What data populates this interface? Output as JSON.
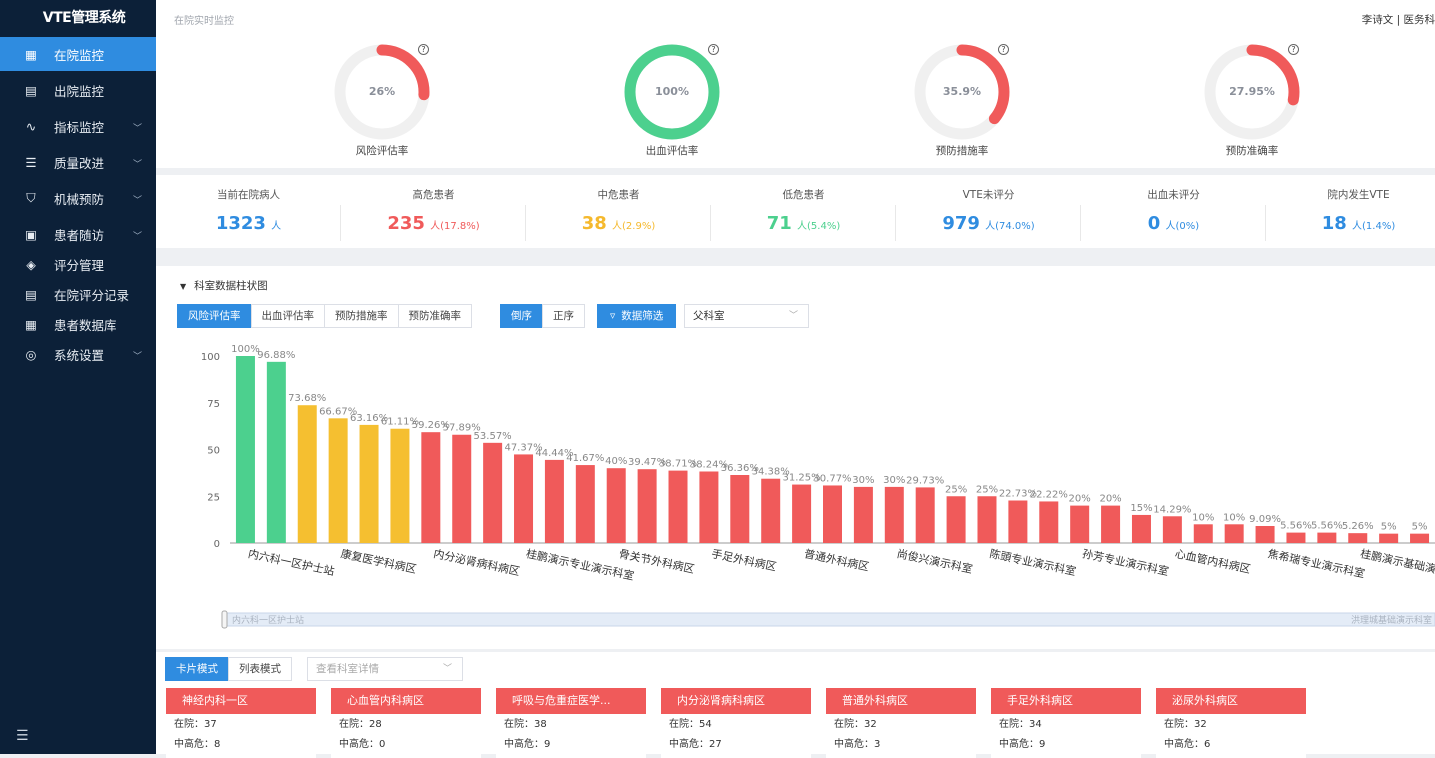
{
  "app_title": "VTE管理系统",
  "sidebar": {
    "items": [
      {
        "label": "在院监控",
        "icon": "building-icon",
        "active": true,
        "has_children": false
      },
      {
        "label": "出院监控",
        "icon": "monitor-icon",
        "active": false,
        "has_children": false
      },
      {
        "label": "指标监控",
        "icon": "pulse-icon",
        "active": false,
        "has_children": true
      },
      {
        "label": "质量改进",
        "icon": "list-icon",
        "active": false,
        "has_children": true
      },
      {
        "label": "机械预防",
        "icon": "shield-bolt-icon",
        "active": false,
        "has_children": true
      },
      {
        "label": "患者随访",
        "icon": "calendar-plus-icon",
        "active": false,
        "has_children": true
      },
      {
        "label": "评分管理",
        "icon": "layers-check-icon",
        "active": false,
        "has_children": false
      },
      {
        "label": "在院评分记录",
        "icon": "document-icon",
        "active": false,
        "has_children": false
      },
      {
        "label": "患者数据库",
        "icon": "database-icon",
        "active": false,
        "has_children": false
      },
      {
        "label": "系统设置",
        "icon": "settings-monitor-icon",
        "active": false,
        "has_children": true
      }
    ],
    "toggle_icon": "menu-fold-icon"
  },
  "header": {
    "breadcrumb": "在院实时监控",
    "user": "李诗文 | 医务科"
  },
  "gauges": [
    {
      "label": "风险评估率",
      "value_text": "26%",
      "value": 26,
      "color": "#f05a5a"
    },
    {
      "label": "出血评估率",
      "value_text": "100%",
      "value": 100,
      "color": "#4cd08e"
    },
    {
      "label": "预防措施率",
      "value_text": "35.9%",
      "value": 35.9,
      "color": "#f05a5a"
    },
    {
      "label": "预防准确率",
      "value_text": "27.95%",
      "value": 27.95,
      "color": "#f05a5a"
    }
  ],
  "stats": [
    {
      "title": "当前在院病人",
      "value": "1323",
      "unit": "人",
      "pct": "",
      "color": "#2f8ce0"
    },
    {
      "title": "高危患者",
      "value": "235",
      "unit": "人",
      "pct": "(17.8%)",
      "color": "#f05a5a"
    },
    {
      "title": "中危患者",
      "value": "38",
      "unit": "人",
      "pct": "(2.9%)",
      "color": "#f5b92d"
    },
    {
      "title": "低危患者",
      "value": "71",
      "unit": "人",
      "pct": "(5.4%)",
      "color": "#4cd08e"
    },
    {
      "title": "VTE未评分",
      "value": "979",
      "unit": "人",
      "pct": "(74.0%)",
      "color": "#2f8ce0"
    },
    {
      "title": "出血未评分",
      "value": "0",
      "unit": "人",
      "pct": "(0%)",
      "color": "#2f8ce0"
    },
    {
      "title": "院内发生VTE",
      "value": "18",
      "unit": "人",
      "pct": "(1.4%)",
      "color": "#2f8ce0"
    }
  ],
  "chart_section": {
    "title": "科室数据柱状图",
    "metric_tabs": [
      "风险评估率",
      "出血评估率",
      "预防措施率",
      "预防准确率"
    ],
    "active_metric": 0,
    "order_tabs": [
      "倒序",
      "正序"
    ],
    "active_order": 0,
    "filter_button": "数据筛选",
    "dept_select": "父科室",
    "slider_start_label": "内六科一区护士站",
    "slider_end_label": "洪理城基础演示科室"
  },
  "chart_data": {
    "type": "bar",
    "ylim": [
      0,
      100
    ],
    "yticks": [
      0,
      25,
      50,
      75,
      100
    ],
    "values": [
      100,
      96.88,
      73.68,
      66.67,
      63.16,
      61.11,
      59.26,
      57.89,
      53.57,
      47.37,
      44.44,
      41.67,
      40,
      39.47,
      38.71,
      38.24,
      36.36,
      34.38,
      31.25,
      30.77,
      30,
      30,
      29.73,
      25,
      25,
      22.73,
      22.22,
      20,
      20,
      15,
      14.29,
      10,
      10,
      9.09,
      5.56,
      5.56,
      5.26,
      5,
      5
    ],
    "value_labels": [
      "100%",
      "96.88%",
      "73.68%",
      "66.67%",
      "63.16%",
      "61.11%",
      "59.26%",
      "57.89%",
      "53.57%",
      "47.37%",
      "44.44%",
      "41.67%",
      "40%",
      "39.47%",
      "38.71%",
      "38.24%",
      "36.36%",
      "34.38%",
      "31.25%",
      "30.77%",
      "30%",
      "30%",
      "29.73%",
      "25%",
      "25%",
      "22.73%",
      "22.22%",
      "20%",
      "20%",
      "15%",
      "14.29%",
      "10%",
      "10%",
      "9.09%",
      "5.56%",
      "5.56%",
      "5.26%",
      "5%",
      "5%"
    ],
    "visible_categories": [
      {
        "index": 0,
        "label": "内六科一区护士站"
      },
      {
        "index": 3,
        "label": "康复医学科病区"
      },
      {
        "index": 6,
        "label": "内分泌肾病科病区"
      },
      {
        "index": 9,
        "label": "桂鹏演示专业演示科室"
      },
      {
        "index": 12,
        "label": "骨关节外科病区"
      },
      {
        "index": 15,
        "label": "手足外科病区"
      },
      {
        "index": 18,
        "label": "普通外科病区"
      },
      {
        "index": 21,
        "label": "尚俊兴演示科室"
      },
      {
        "index": 24,
        "label": "陈頭专业演示科室"
      },
      {
        "index": 27,
        "label": "孙芳专业演示科室"
      },
      {
        "index": 30,
        "label": "心血管内科病区"
      },
      {
        "index": 33,
        "label": "焦希瑞专业演示科室"
      },
      {
        "index": 36,
        "label": "桂鹏演示基础演示科室"
      }
    ],
    "color_rules": {
      "high": "#4cd08e",
      "mid": "#f5bf30",
      "low": "#f05a5a"
    },
    "bar_colors_by_index": {
      "green": [
        0,
        1
      ],
      "yellow": [
        2,
        3,
        4,
        5
      ]
    }
  },
  "bottom": {
    "view_tabs": [
      "卡片模式",
      "列表模式"
    ],
    "active_view": 0,
    "detail_select_placeholder": "查看科室详情",
    "cards": [
      {
        "title": "神经内科一区",
        "line1": "在院：37",
        "line2": "中高危：8"
      },
      {
        "title": "心血管内科病区",
        "line1": "在院：28",
        "line2": "中高危：0"
      },
      {
        "title": "呼吸与危重症医学...",
        "line1": "在院：38",
        "line2": "中高危：9"
      },
      {
        "title": "内分泌肾病科病区",
        "line1": "在院：54",
        "line2": "中高危：27"
      },
      {
        "title": "普通外科病区",
        "line1": "在院：32",
        "line2": "中高危：3"
      },
      {
        "title": "手足外科病区",
        "line1": "在院：34",
        "line2": "中高危：9"
      },
      {
        "title": "泌尿外科病区",
        "line1": "在院：32",
        "line2": "中高危：6"
      }
    ]
  }
}
